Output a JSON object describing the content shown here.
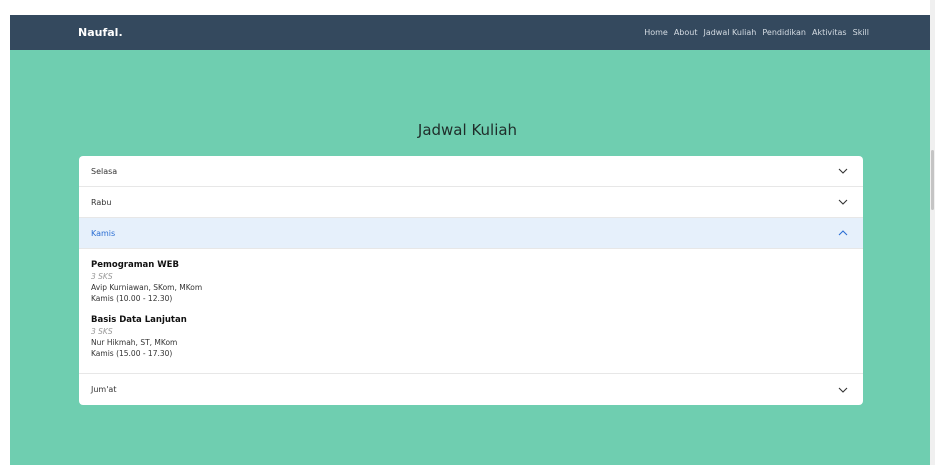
{
  "navbar": {
    "brand": "Naufal.",
    "links": [
      "Home",
      "About",
      "Jadwal Kuliah",
      "Pendidikan",
      "Aktivitas",
      "Skill"
    ]
  },
  "section": {
    "title": "Jadwal Kuliah"
  },
  "accordion": {
    "items": [
      {
        "day": "Selasa",
        "expanded": false
      },
      {
        "day": "Rabu",
        "expanded": false
      },
      {
        "day": "Kamis",
        "expanded": true,
        "courses": [
          {
            "name": "Pemograman WEB",
            "sks": "3 SKS",
            "lecturer": "Avip Kurniawan, SKom, MKom",
            "time": "Kamis (10.00 - 12.30)"
          },
          {
            "name": "Basis Data Lanjutan",
            "sks": "3 SKS",
            "lecturer": "Nur Hikmah, ST, MKom",
            "time": "Kamis (15.00 - 17.30)"
          }
        ]
      },
      {
        "day": "Jum'at",
        "expanded": false
      }
    ]
  },
  "colors": {
    "navbar": "#34495e",
    "hero": "#6fceb0",
    "active_header_bg": "#e6f0fb",
    "active_header_text": "#2b6ed3"
  },
  "icons": {
    "collapsed": "chevron-down-icon",
    "expanded": "chevron-up-icon"
  }
}
